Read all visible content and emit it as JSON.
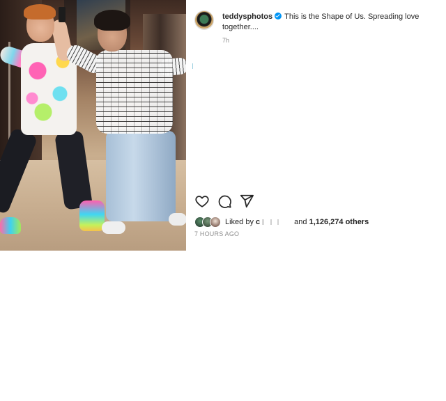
{
  "post": {
    "username": "teddysphotos",
    "caption": "This is the Shape of Us. Spreading love together....",
    "timestamp_short": "7h"
  },
  "actions": {
    "like_icon": "heart-icon",
    "comment_icon": "comment-icon",
    "share_icon": "share-icon",
    "save_icon": "bookmark-icon"
  },
  "likes": {
    "prefix": "Liked by",
    "liker": "c",
    "connector": "and",
    "count_text": "1,126,274 others"
  },
  "time_ago": "7 HOURS AGO",
  "colors": {
    "verified": "#0095f6",
    "secondary_text": "#8e8e8e",
    "primary_text": "#262626"
  }
}
